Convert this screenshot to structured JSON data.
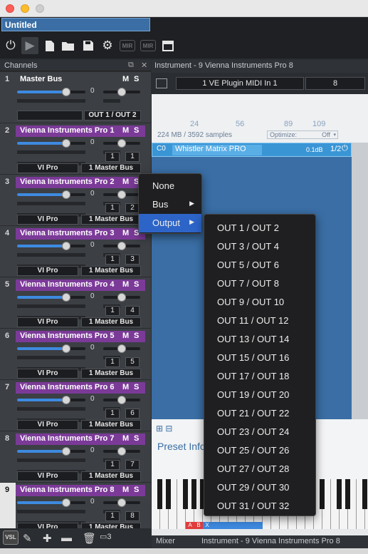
{
  "window": {
    "project_name": "Untitled"
  },
  "toolbar": {
    "mir1": "MIR",
    "mir2": "MIR"
  },
  "channels_panel": {
    "title": "Channels"
  },
  "channels": [
    {
      "num": "1",
      "name": "Master Bus",
      "volume": "0",
      "output": "OUT 1 / OUT 2",
      "master": true,
      "fader_fill": 0.72
    },
    {
      "num": "2",
      "name": "Vienna Instruments Pro 1",
      "volume": "0",
      "midi_in": "1",
      "midi_ch": "1",
      "input": "VI Pro",
      "output": "1 Master Bus",
      "fader_fill": 0.72
    },
    {
      "num": "3",
      "name": "Vienna Instruments Pro 2",
      "volume": "0",
      "midi_in": "1",
      "midi_ch": "2",
      "input": "VI Pro",
      "output": "1 Master Bus",
      "fader_fill": 0.72
    },
    {
      "num": "4",
      "name": "Vienna Instruments Pro 3",
      "volume": "0",
      "midi_in": "1",
      "midi_ch": "3",
      "input": "VI Pro",
      "output": "1 Master Bus",
      "fader_fill": 0.72
    },
    {
      "num": "5",
      "name": "Vienna Instruments Pro 4",
      "volume": "0",
      "midi_in": "1",
      "midi_ch": "4",
      "input": "VI Pro",
      "output": "1 Master Bus",
      "fader_fill": 0.72
    },
    {
      "num": "6",
      "name": "Vienna Instruments Pro 5",
      "volume": "0",
      "midi_in": "1",
      "midi_ch": "5",
      "input": "VI Pro",
      "output": "1 Master Bus",
      "fader_fill": 0.72
    },
    {
      "num": "7",
      "name": "Vienna Instruments Pro 6",
      "volume": "0",
      "midi_in": "1",
      "midi_ch": "6",
      "input": "VI Pro",
      "output": "1 Master Bus",
      "fader_fill": 0.72
    },
    {
      "num": "8",
      "name": "Vienna Instruments Pro 7",
      "volume": "0",
      "midi_in": "1",
      "midi_ch": "7",
      "input": "VI Pro",
      "output": "1 Master Bus",
      "fader_fill": 0.72
    },
    {
      "num": "9",
      "name": "Vienna Instruments Pro 8",
      "volume": "0",
      "midi_in": "1",
      "midi_ch": "8",
      "input": "VI Pro",
      "output": "1 Master Bus",
      "fader_fill": 0.72,
      "selected": true
    }
  ],
  "instrument": {
    "title": "Instrument - 9 Vienna Instruments Pro 8",
    "plugin_midi": "1 VE Plugin MIDI In 1",
    "midi_channel": "8",
    "ruler": [
      "24",
      "56",
      "89",
      "109"
    ],
    "memory": "224 MB / 3592 samples",
    "optimize_label": "Optimize:",
    "optimize_value": "Off",
    "slot": {
      "cell": "C0",
      "name": "Whistler Matrix PRO",
      "level": "0.1dB",
      "output": "1/2"
    },
    "preset_title": "Preset Info"
  },
  "keyboard": {
    "mark_a": "A",
    "mark_b": "B",
    "mark_x": "X"
  },
  "mixer_bar": {
    "tab": "Mixer",
    "title": "Instrument - 9 Vienna Instruments Pro 8"
  },
  "context_menu": {
    "items": [
      "None",
      "Bus",
      "Output"
    ],
    "submenu": [
      "OUT 1 / OUT 2",
      "OUT 3 / OUT 4",
      "OUT 5 / OUT 6",
      "OUT 7 / OUT 8",
      "OUT 9 / OUT 10",
      "OUT 11 / OUT 12",
      "OUT 13 / OUT 14",
      "OUT 15 / OUT 16",
      "OUT 17 / OUT 18",
      "OUT 19 / OUT 20",
      "OUT 21 / OUT 22",
      "OUT 23 / OUT 24",
      "OUT 25 / OUT 26",
      "OUT 27 / OUT 28",
      "OUT 29 / OUT 30",
      "OUT 31 / OUT 32"
    ]
  },
  "bottom_bar": {
    "vsl": "VSL"
  }
}
